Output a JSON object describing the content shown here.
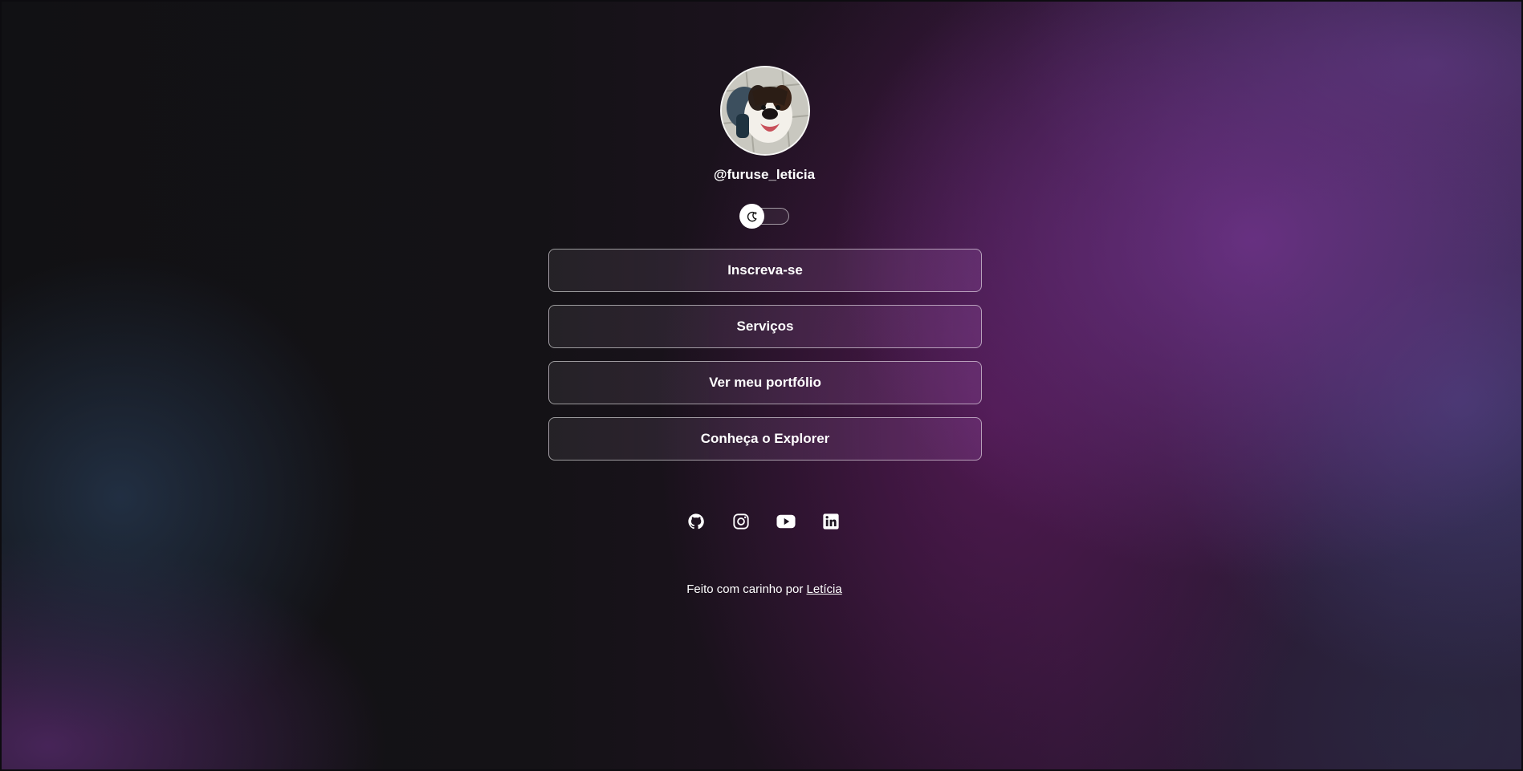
{
  "profile": {
    "username": "@furuse_leticia",
    "avatar_icon": "dog-photo-avatar"
  },
  "theme_toggle": {
    "icon": "moon-icon",
    "state": "off"
  },
  "links": [
    {
      "label": "Inscreva-se"
    },
    {
      "label": "Serviços"
    },
    {
      "label": "Ver meu portfólio"
    },
    {
      "label": "Conheça o Explorer"
    }
  ],
  "socials": [
    {
      "icon": "github-icon"
    },
    {
      "icon": "instagram-icon"
    },
    {
      "icon": "youtube-icon"
    },
    {
      "icon": "linkedin-icon"
    }
  ],
  "footer": {
    "text": "Feito com carinho por",
    "author_link": "Letícia"
  },
  "colors": {
    "background": "#161317",
    "accent_purple": "#70348c",
    "text": "#ffffff"
  }
}
